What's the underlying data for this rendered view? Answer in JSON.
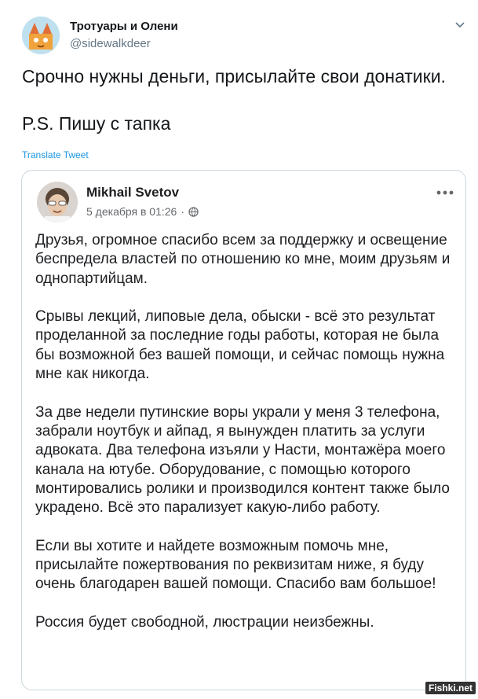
{
  "tweet": {
    "author_name": "Тротуары и Олени",
    "author_handle": "@sidewalkdeer",
    "paragraphs": [
      "Срочно нужны деньги, присылайте свои донатики.",
      "P.S. Пишу с тапка"
    ],
    "translate_link": "Translate Tweet"
  },
  "embedded_post": {
    "author_name": "Mikhail Svetov",
    "date": "5 декабря в 01:26",
    "separator": "·",
    "paragraphs": [
      "Друзья, огромное спасибо всем за поддержку и освещение беспредела властей по отношению ко мне, моим друзьям и однопартийцам.",
      "Срывы лекций, липовые дела, обыски - всё это результат проделанной за последние годы работы, которая не была бы возможной без вашей помощи, и сейчас помощь нужна мне как никогда.",
      "За две недели путинские воры украли у меня 3 телефона, забрали ноутбук и айпад, я вынужден платить за услуги адвоката. Два телефона изъяли у Насти, монтажёра моего канала на ютубе. Оборудование, с помощью которого монтировались ролики и производился контент также было украдено. Всё это парализует какую-либо работу.",
      "Если вы хотите и найдете возможным помочь мне, присылайте пожертвования по реквизитам ниже, я буду очень благодарен вашей помощи. Спасибо вам большое!",
      "Россия будет свободной, люстрации неизбежны."
    ]
  },
  "watermark": "Fishki.net",
  "icons": {
    "tweet_menu": "chevron-down-icon",
    "post_menu": "more-horizontal-icon",
    "privacy": "globe-icon"
  },
  "colors": {
    "link": "#1b95e0",
    "text": "#14171a",
    "secondary": "#657786",
    "card_border": "#ccd6dd"
  }
}
